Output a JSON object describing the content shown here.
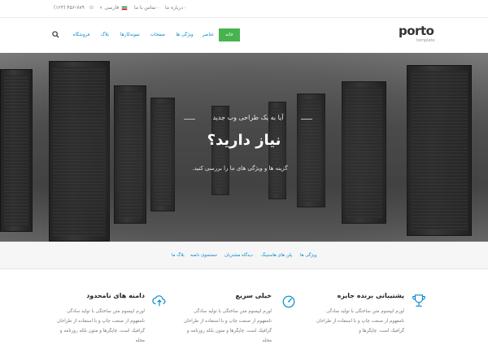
{
  "topbar": {
    "phone": "(۱۲۳) ۴۵۶-۷۸۹",
    "language": "فارسی",
    "contact": "تماس با ما",
    "about": "درباره ما"
  },
  "header": {
    "logo_word": "porto",
    "logo_sub": "template",
    "nav": [
      {
        "label": "خانه",
        "active": true
      },
      {
        "label": "عناصر",
        "active": false
      },
      {
        "label": "ویژگی ها",
        "active": false
      },
      {
        "label": "صفحات",
        "active": false
      },
      {
        "label": "نمونه‌کارها",
        "active": false
      },
      {
        "label": "بلاگ",
        "active": false
      },
      {
        "label": "فروشگاه",
        "active": false
      }
    ]
  },
  "hero": {
    "subtitle": "آیا به یک طراحی وب جدید",
    "title": "نیاز دارید؟",
    "description": "گزینه ها و ویژگی های ما را بررسی کنید."
  },
  "subnav": {
    "items": [
      "ویژگی ها",
      "پلن های هاستینگ",
      "دیدگاه مشتریان",
      "جستجوی دامنه",
      "بلاگ ما"
    ]
  },
  "features": [
    {
      "icon": "trophy-icon",
      "title": "پشتیبانی برنده جایزه",
      "lines": [
        "لورم ایپسوم متن ساختگی با تولید سادگی",
        "نامفهوم از صنعت چاپ و با استفاده از طراحان",
        "گرافیک است. چاپگرها و"
      ]
    },
    {
      "icon": "speedometer-icon",
      "title": "خیلی سریع",
      "lines": [
        "لورم ایپسوم متن ساختگی با تولید سادگی",
        "نامفهوم از صنعت چاپ و با استفاده از طراحان",
        "گرافیک است. چاپگرها و متون بلکه روزنامه و",
        "مجله"
      ]
    },
    {
      "icon": "cloud-upload-icon",
      "title": "دامنه های نامحدود",
      "lines": [
        "لورم ایپسوم متن ساختگی با تولید سادگی",
        "نامفهوم از صنعت چاپ و با استفاده از طراحان",
        "گرافیک است. چاپگرها و متون بلکه روزنامه و",
        "مجله"
      ]
    }
  ],
  "colors": {
    "accent_green": "#47b34f",
    "link_blue": "#0088cc"
  }
}
